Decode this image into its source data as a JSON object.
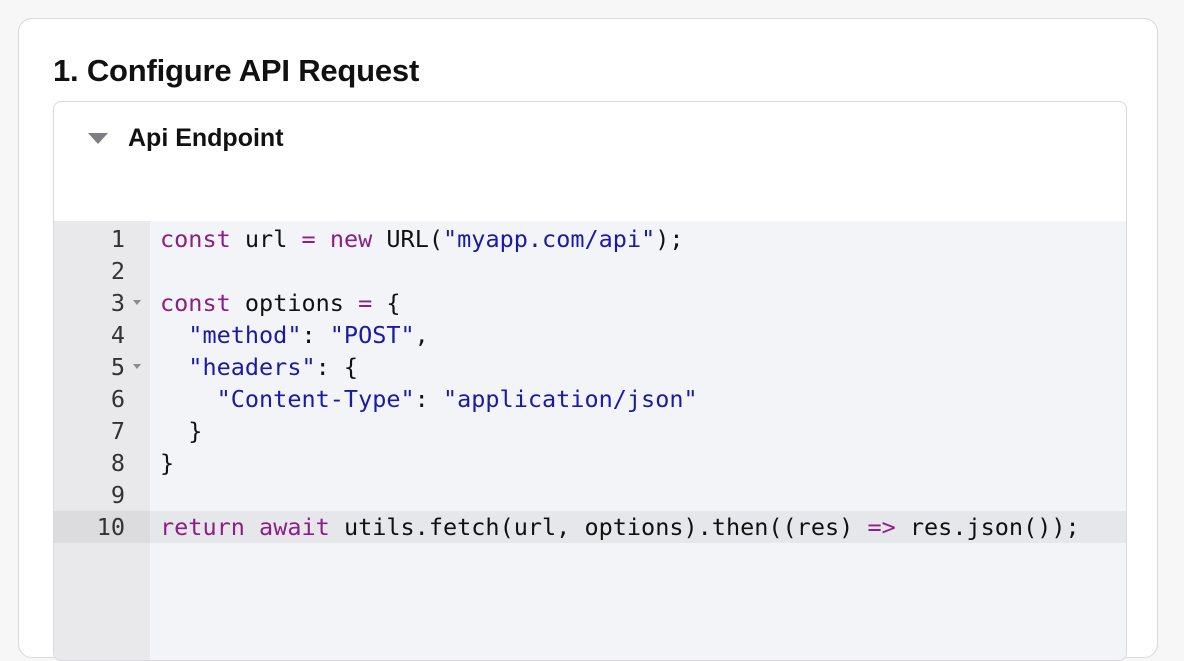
{
  "section": {
    "title": "1. Configure API Request"
  },
  "panel": {
    "title": "Api Endpoint",
    "expanded": true,
    "caret_icon": "triangle-down-icon"
  },
  "editor": {
    "active_line": 10,
    "fold_markers_on_lines": [
      3,
      5
    ],
    "colors": {
      "keyword": "#8c1e86",
      "string": "#1a1aa6",
      "text": "#111111",
      "background": "#f3f4f8",
      "gutter": "#e9e9ec"
    },
    "lines": [
      {
        "num": "1",
        "tokens": [
          {
            "t": "kw",
            "v": "const"
          },
          {
            "t": "p",
            "v": " url "
          },
          {
            "t": "op",
            "v": "="
          },
          {
            "t": "p",
            "v": " "
          },
          {
            "t": "kw",
            "v": "new"
          },
          {
            "t": "p",
            "v": " URL("
          },
          {
            "t": "str",
            "v": "\"myapp.com/api\""
          },
          {
            "t": "p",
            "v": ");"
          }
        ]
      },
      {
        "num": "2",
        "tokens": []
      },
      {
        "num": "3",
        "tokens": [
          {
            "t": "kw",
            "v": "const"
          },
          {
            "t": "p",
            "v": " options "
          },
          {
            "t": "op",
            "v": "="
          },
          {
            "t": "p",
            "v": " {"
          }
        ]
      },
      {
        "num": "4",
        "tokens": [
          {
            "t": "p",
            "v": "  "
          },
          {
            "t": "str",
            "v": "\"method\""
          },
          {
            "t": "p",
            "v": ": "
          },
          {
            "t": "str",
            "v": "\"POST\""
          },
          {
            "t": "p",
            "v": ","
          }
        ]
      },
      {
        "num": "5",
        "tokens": [
          {
            "t": "p",
            "v": "  "
          },
          {
            "t": "str",
            "v": "\"headers\""
          },
          {
            "t": "p",
            "v": ": {"
          }
        ]
      },
      {
        "num": "6",
        "tokens": [
          {
            "t": "p",
            "v": "    "
          },
          {
            "t": "str",
            "v": "\"Content-Type\""
          },
          {
            "t": "p",
            "v": ": "
          },
          {
            "t": "str",
            "v": "\"application/json\""
          }
        ]
      },
      {
        "num": "7",
        "tokens": [
          {
            "t": "p",
            "v": "  }"
          }
        ]
      },
      {
        "num": "8",
        "tokens": [
          {
            "t": "p",
            "v": "}"
          }
        ]
      },
      {
        "num": "9",
        "tokens": []
      },
      {
        "num": "10",
        "tokens": [
          {
            "t": "kw",
            "v": "return"
          },
          {
            "t": "p",
            "v": " "
          },
          {
            "t": "kw",
            "v": "await"
          },
          {
            "t": "p",
            "v": " utils.fetch(url, options).then((res) "
          },
          {
            "t": "op",
            "v": "=>"
          },
          {
            "t": "p",
            "v": " res.json());"
          }
        ]
      }
    ]
  }
}
